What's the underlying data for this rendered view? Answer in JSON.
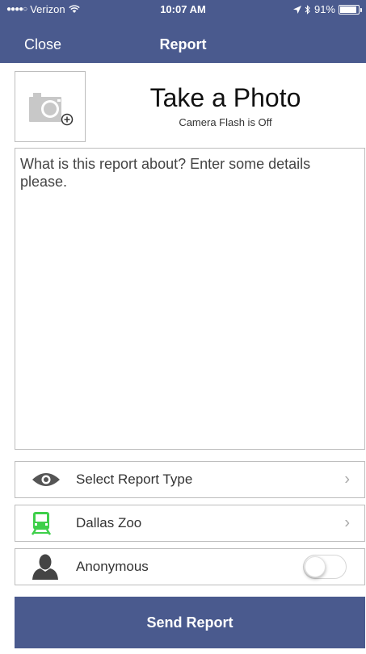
{
  "status_bar": {
    "carrier": "Verizon",
    "time": "10:07 AM",
    "battery": "91%",
    "battery_level": 0.91
  },
  "nav": {
    "close_label": "Close",
    "title": "Report"
  },
  "photo": {
    "icon": "camera-add-icon",
    "title": "Take a Photo",
    "flash_status": "Camera Flash is Off"
  },
  "details": {
    "placeholder": "What is this report about? Enter some details please.",
    "value": ""
  },
  "options": {
    "report_type": {
      "label": "Select Report Type",
      "icon": "eye-icon"
    },
    "location": {
      "label": "Dallas Zoo",
      "icon": "train-icon",
      "icon_color": "#3ecf4a"
    },
    "anonymous": {
      "label": "Anonymous",
      "icon": "person-icon",
      "enabled": false
    }
  },
  "send_label": "Send Report",
  "colors": {
    "brand": "#4a5a8e",
    "border": "#bdbdbd"
  }
}
